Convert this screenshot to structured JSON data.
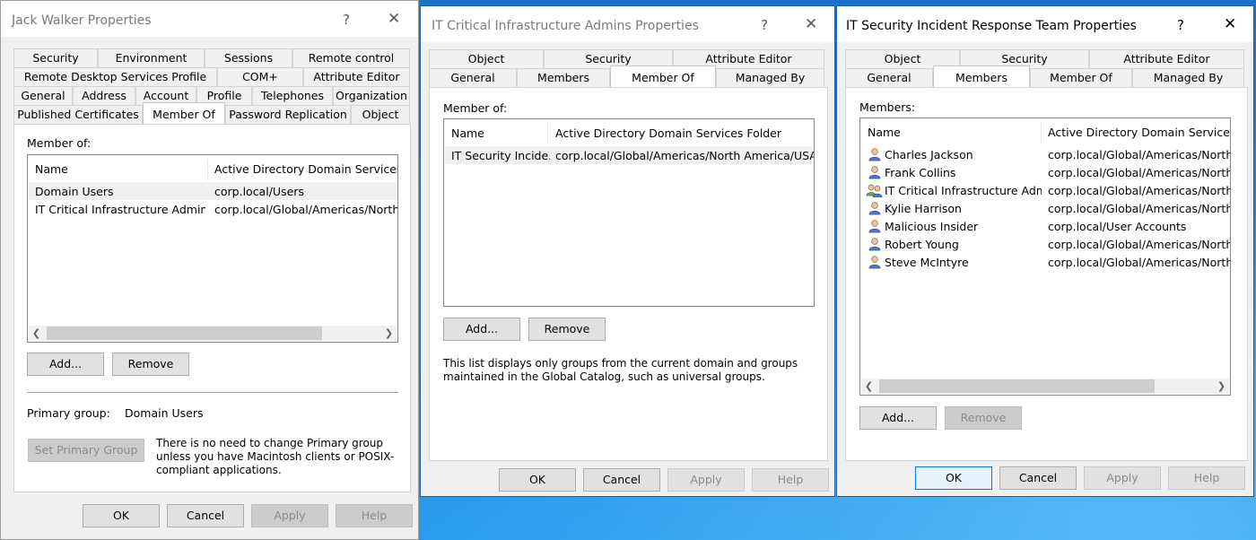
{
  "win1": {
    "title": "Jack Walker Properties",
    "help_glyph": "?",
    "close_glyph": "✕",
    "tab_rows": [
      [
        "Security",
        "Environment",
        "Sessions",
        "Remote control"
      ],
      [
        "Remote Desktop Services Profile",
        "COM+",
        "Attribute Editor"
      ],
      [
        "General",
        "Address",
        "Account",
        "Profile",
        "Telephones",
        "Organization"
      ],
      [
        "Published Certificates",
        "Member Of",
        "Password Replication",
        "Object"
      ]
    ],
    "member_of_label": "Member of:",
    "columns": [
      "Name",
      "Active Directory Domain Services Folder"
    ],
    "rows": [
      {
        "name": "Domain Users",
        "folder": "corp.local/Users"
      },
      {
        "name": "IT Critical Infrastructure Admins",
        "folder": "corp.local/Global/Americas/North America"
      }
    ],
    "add_label": "Add...",
    "remove_label": "Remove",
    "primary_group_label": "Primary group:",
    "primary_group_value": "Domain Users",
    "set_primary_label": "Set Primary Group",
    "primary_note": "There is no need to change Primary group unless you have Macintosh clients or POSIX-compliant applications.",
    "ok": "OK",
    "cancel": "Cancel",
    "apply": "Apply",
    "help": "Help"
  },
  "win2": {
    "title": "IT Critical Infrastructure Admins Properties",
    "help_glyph": "?",
    "close_glyph": "✕",
    "tab_rows": [
      [
        "Object",
        "Security",
        "Attribute Editor"
      ],
      [
        "General",
        "Members",
        "Member Of",
        "Managed By"
      ]
    ],
    "member_of_label": "Member of:",
    "columns": [
      "Name",
      "Active Directory Domain Services Folder"
    ],
    "rows": [
      {
        "name": "IT Security Incide...",
        "folder": "corp.local/Global/Americas/North America/USA/S..."
      }
    ],
    "add_label": "Add...",
    "remove_label": "Remove",
    "note": "This list displays only groups from the current domain and groups maintained in the Global Catalog, such as universal groups.",
    "ok": "OK",
    "cancel": "Cancel",
    "apply": "Apply",
    "help": "Help"
  },
  "win3": {
    "title": "IT Security Incident Response Team Properties",
    "help_glyph": "?",
    "close_glyph": "✕",
    "tab_rows": [
      [
        "Object",
        "Security",
        "Attribute Editor"
      ],
      [
        "General",
        "Members",
        "Member Of",
        "Managed By"
      ]
    ],
    "members_label": "Members:",
    "columns": [
      "Name",
      "Active Directory Domain Services Folder"
    ],
    "rows": [
      {
        "name": "Charles Jackson",
        "folder": "corp.local/Global/Americas/North America",
        "icon": "user-icon"
      },
      {
        "name": "Frank Collins",
        "folder": "corp.local/Global/Americas/North America",
        "icon": "user-icon"
      },
      {
        "name": "IT Critical Infrastructure Admins",
        "folder": "corp.local/Global/Americas/North America",
        "icon": "group-icon"
      },
      {
        "name": "Kylie Harrison",
        "folder": "corp.local/Global/Americas/North America",
        "icon": "user-icon"
      },
      {
        "name": "Malicious Insider",
        "folder": "corp.local/User Accounts",
        "icon": "user-icon"
      },
      {
        "name": "Robert Young",
        "folder": "corp.local/Global/Americas/North America",
        "icon": "user-icon"
      },
      {
        "name": "Steve McIntyre",
        "folder": "corp.local/Global/Americas/North America",
        "icon": "user-icon"
      }
    ],
    "add_label": "Add...",
    "remove_label": "Remove",
    "ok": "OK",
    "cancel": "Cancel",
    "apply": "Apply",
    "help": "Help"
  },
  "colors": {
    "desktop": "#1f8ae0",
    "dialog_bg": "#f0f0f0",
    "active_border": "#1b5fa8",
    "default_button_border": "#0078d7"
  }
}
